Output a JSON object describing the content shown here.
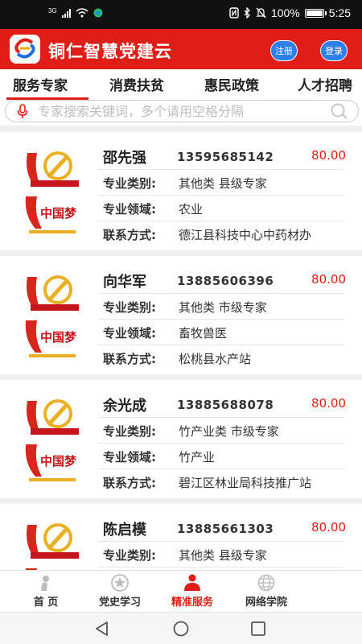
{
  "status_bar": {
    "network": "3G",
    "battery": "100%",
    "time": "5:25"
  },
  "header": {
    "title": "铜仁智慧党建云",
    "register_label": "注册",
    "login_label": "登录"
  },
  "tabs": [
    {
      "label": "服务专家",
      "active": true
    },
    {
      "label": "消费扶贫",
      "active": false
    },
    {
      "label": "惠民政策",
      "active": false
    },
    {
      "label": "人才招聘",
      "active": false
    }
  ],
  "search": {
    "placeholder": "专家搜索关键词，多个请用空格分隔"
  },
  "labels": {
    "category": "专业类别:",
    "field": "专业领域:",
    "contact": "联系方式:"
  },
  "experts": [
    {
      "name": "邵先强",
      "phone": "13595685142",
      "price": "80.00",
      "category": "其他类  县级专家",
      "field": "农业",
      "contact": "德江县科技中心中药材办"
    },
    {
      "name": "向华军",
      "phone": "13885606396",
      "price": "80.00",
      "category": "其他类  市级专家",
      "field": "畜牧兽医",
      "contact": "松桃县水产站"
    },
    {
      "name": "余光成",
      "phone": "13885688078",
      "price": "80.00",
      "category": "竹产业类  市级专家",
      "field": "竹产业",
      "contact": "碧江区林业局科技推广站"
    },
    {
      "name": "陈启模",
      "phone": "13885661303",
      "price": "80.00",
      "category": "其他类  县级专家",
      "field": "",
      "contact": ""
    }
  ],
  "bottom_nav": [
    {
      "label": "首  页",
      "icon": "home-icon",
      "active": false
    },
    {
      "label": "党史学习",
      "icon": "star-icon",
      "active": false
    },
    {
      "label": "精准服务",
      "icon": "person-icon",
      "active": true
    },
    {
      "label": "网络学院",
      "icon": "globe-icon",
      "active": false
    }
  ],
  "colors": {
    "primary": "#e01d17",
    "button_blue": "#2f7fe8",
    "active_nav": "#e01d17"
  }
}
